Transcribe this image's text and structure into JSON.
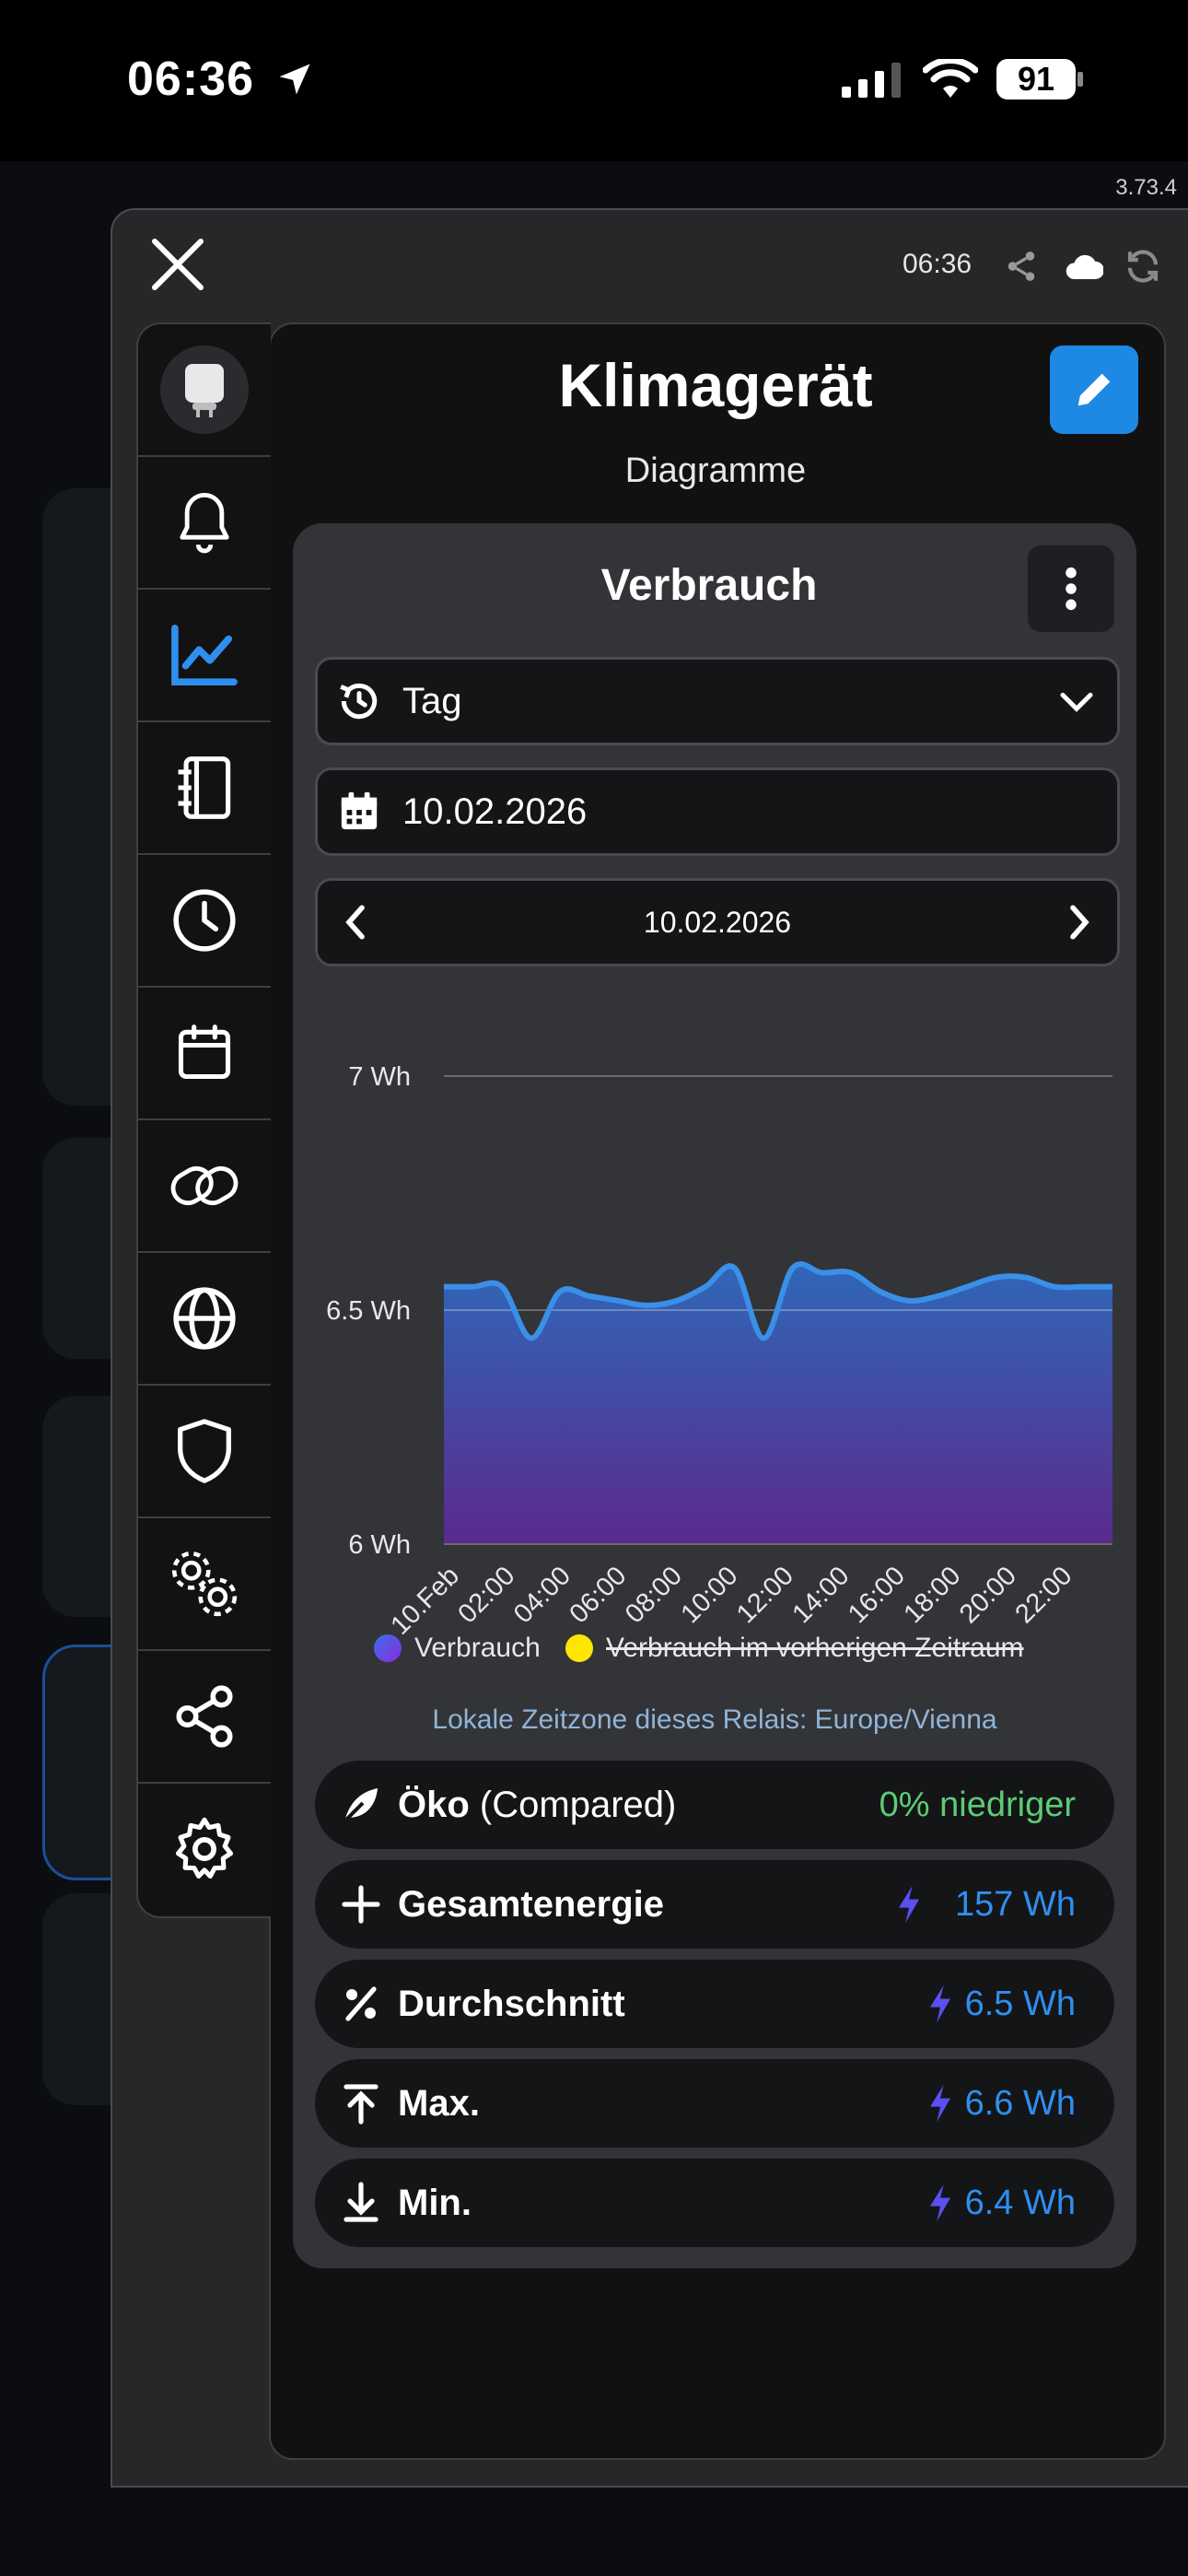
{
  "status_bar": {
    "time": "06:36",
    "battery": "91"
  },
  "version": "3.73.4",
  "modal": {
    "time": "06:36",
    "title": "Klimagerät",
    "subtitle": "Diagramme"
  },
  "sidebar": {
    "items": [
      {
        "icon": "plug-icon"
      },
      {
        "icon": "bell-icon"
      },
      {
        "icon": "chart-icon",
        "active": true
      },
      {
        "icon": "logbook-icon"
      },
      {
        "icon": "clock-icon"
      },
      {
        "icon": "calendar-icon"
      },
      {
        "icon": "link-icon"
      },
      {
        "icon": "globe-icon"
      },
      {
        "icon": "shield-icon"
      },
      {
        "icon": "gears-icon"
      },
      {
        "icon": "share-icon"
      },
      {
        "icon": "gear-icon"
      }
    ]
  },
  "card": {
    "title": "Verbrauch",
    "range_select": "Tag",
    "date_input": "10.02.2026",
    "date_nav": "10.02.2026",
    "timezone_note": "Lokale Zeitzone dieses Relais: Europe/Vienna"
  },
  "chart_data": {
    "type": "area",
    "x": [
      "10.Feb",
      "",
      "02:00",
      "",
      "04:00",
      "",
      "06:00",
      "",
      "08:00",
      "",
      "10:00",
      "",
      "12:00",
      "",
      "14:00",
      "",
      "16:00",
      "",
      "18:00",
      "",
      "20:00",
      "",
      "22:00",
      ""
    ],
    "tick_labels": [
      "10.Feb",
      "02:00",
      "04:00",
      "06:00",
      "08:00",
      "10:00",
      "12:00",
      "14:00",
      "16:00",
      "18:00",
      "20:00",
      "22:00"
    ],
    "series": [
      {
        "name": "Verbrauch",
        "values": [
          6.55,
          6.55,
          6.55,
          6.44,
          6.54,
          6.53,
          6.52,
          6.51,
          6.52,
          6.55,
          6.59,
          6.44,
          6.59,
          6.58,
          6.58,
          6.54,
          6.52,
          6.53,
          6.55,
          6.57,
          6.57,
          6.55,
          6.55,
          6.55
        ],
        "color": "#3a8fe8"
      },
      {
        "name": "Verbrauch im vorherigen Zeitraum",
        "values": [],
        "color": "#ffe600",
        "hidden": true
      }
    ],
    "y_ticks": [
      "6 Wh",
      "6.5 Wh",
      "7 Wh"
    ],
    "ylim": [
      6,
      7
    ]
  },
  "stats": [
    {
      "icon": "leaf-icon",
      "label": "Öko",
      "suffix": "(Compared)",
      "value": "0% niedriger",
      "value_color": "#5ecb74"
    },
    {
      "icon": "plus-icon",
      "label": "Gesamtenergie",
      "value": "157 Wh"
    },
    {
      "icon": "percent-icon",
      "label": "Durchschnitt",
      "value": "6.5 Wh"
    },
    {
      "icon": "max-icon",
      "label": "Max.",
      "value": "6.6 Wh"
    },
    {
      "icon": "min-icon",
      "label": "Min.",
      "value": "6.4 Wh"
    }
  ],
  "colors": {
    "accent": "#1e88e5",
    "value": "#2f8ff0",
    "eco": "#5ecb74",
    "bolt": "#5a4ff0"
  }
}
